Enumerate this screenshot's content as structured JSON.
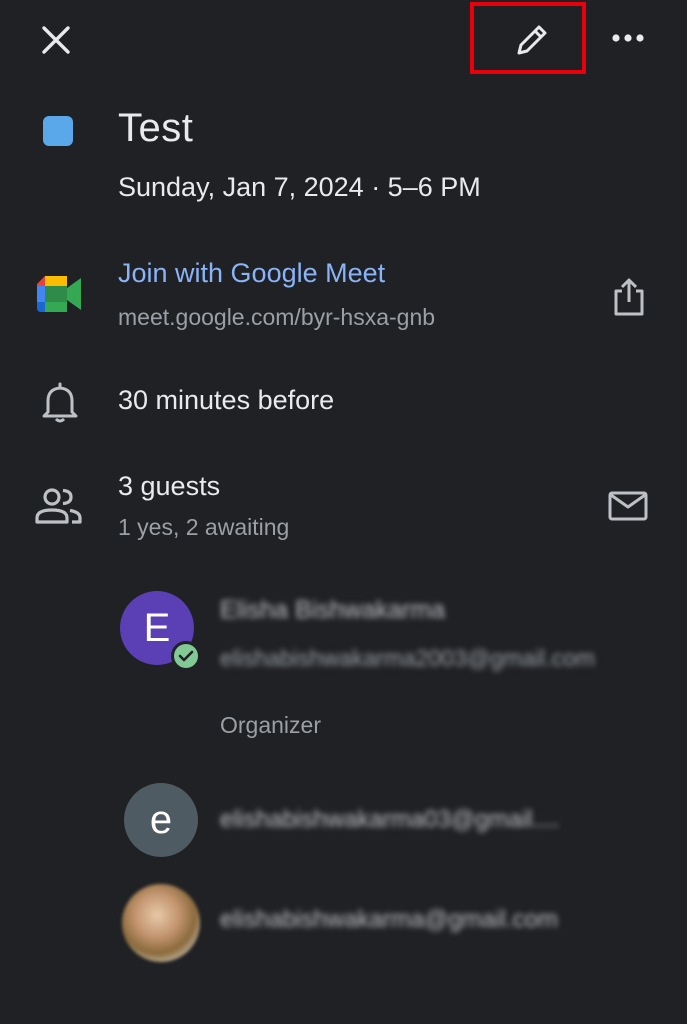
{
  "top_bar": {
    "close_icon": "close-icon",
    "edit_icon": "pencil-icon",
    "more_icon": "more-horizontal-icon",
    "highlight_color": "#e8000b"
  },
  "event": {
    "title": "Test",
    "color": "#5aa8ea",
    "datetime": "Sunday, Jan 7, 2024 · 5–6 PM"
  },
  "meet": {
    "link_label": "Join with Google Meet",
    "url": "meet.google.com/byr-hsxa-gnb",
    "icon": "google-meet-icon",
    "share_icon": "share-icon"
  },
  "notification": {
    "icon": "bell-icon",
    "text": "30 minutes before"
  },
  "guests": {
    "icon": "people-icon",
    "count_label": "3 guests",
    "summary": "1 yes, 2 awaiting",
    "mail_icon": "mail-icon",
    "list": [
      {
        "initial": "E",
        "name": "Elisha Bishwakarma",
        "email": "elishabishwakarma2003@gmail.com",
        "role": "Organizer",
        "status_icon": "check-icon"
      },
      {
        "initial": "e",
        "email": "elishabishwakarma03@gmail...."
      },
      {
        "email": "elishabishwakarma@gmail.com"
      }
    ]
  }
}
